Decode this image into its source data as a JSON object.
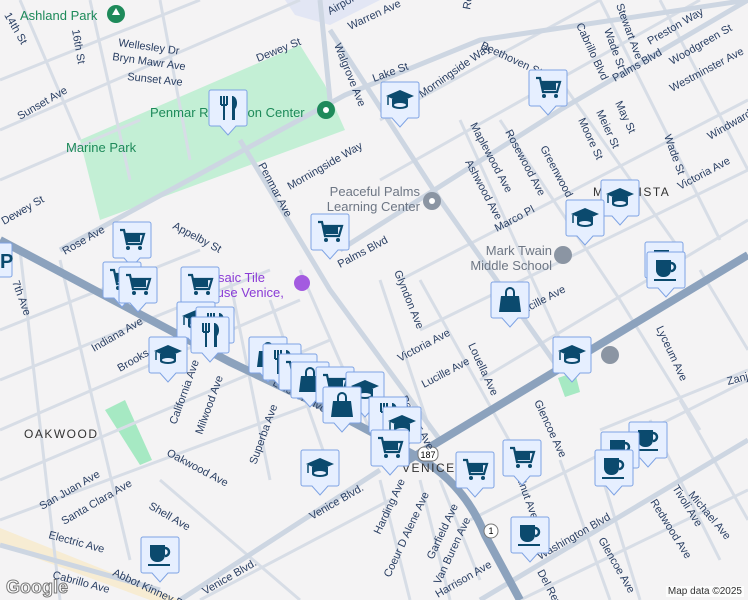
{
  "map": {
    "attribution": "Map data ©2025",
    "logo": "Google",
    "neighborhoods": [
      "OAKWOOD",
      "MAR VISTA",
      "VENICE"
    ],
    "pois": [
      {
        "name": "Ashland Park",
        "icon": "tree-icon"
      },
      {
        "name": "Penmar Recreation Center",
        "icon": "pin-icon"
      },
      {
        "name": "Marine Park",
        "icon": "park"
      },
      {
        "name": "Peaceful Palms Learning Center",
        "icon": "pin-icon"
      },
      {
        "name": "Mark Twain Middle School",
        "icon": "school-icon"
      },
      {
        "name": "Mosaic Tile House Venice, CA",
        "icon": "camera-icon"
      }
    ],
    "streets": [
      "14th St",
      "16th St",
      "Wellesley Dr",
      "Bryn Mawr Ave",
      "Sunset Ave",
      "Dewey St",
      "Airport Ave",
      "Warren Ave",
      "Walgrove Ave",
      "Rose Ave",
      "Lake St",
      "Morningside Way",
      "Beethoven St",
      "Penmar Ave",
      "Appelby St",
      "Palms Blvd",
      "Maplewood Ave",
      "Rosewood Ave",
      "Greenwood Ave",
      "Ashwood Ave",
      "Marco Pl",
      "Cabrillo Blvd",
      "Wade St",
      "Stewart Ave",
      "Preston Way",
      "Woodgreen St",
      "Westminster Ave",
      "Moore St",
      "Meier St",
      "May St",
      "Victoria Ave",
      "Windward Ave",
      "Lucille Ave",
      "Glyndon Ave",
      "Louella Ave",
      "Lyceum Ave",
      "Glencoe Ave",
      "Indiana Ave",
      "Brooks Ave",
      "California Ave",
      "Milwood Ave",
      "Superba Ave",
      "Lincoln Blvd",
      "Oakwood Ave",
      "San Juan Ave",
      "Santa Clara Ave",
      "Shell Ave",
      "Electric Ave",
      "Venice Blvd.",
      "Abbot Kinney Blvd",
      "Cabrillo Ave",
      "Harding Ave",
      "Coeur D Alene Ave",
      "Garfield Ave",
      "Van Buren Ave",
      "Harrison Ave",
      "Washington Blvd",
      "Michael Ave",
      "Tivoli Ave",
      "Redwood Ave",
      "Del Rey Ave",
      "7th Ave",
      "Walnut Ave",
      "Zanja St"
    ],
    "shields": [
      "187",
      "1"
    ],
    "markers": [
      "restaurant",
      "cart",
      "graduation",
      "cup",
      "bag",
      "parking"
    ],
    "colors": {
      "park": "#c3efd5",
      "marker_bg": "#e6efff",
      "marker_border": "#7ea3e4",
      "icon": "#0b4a6e",
      "highway": "#8ca2bd"
    }
  }
}
